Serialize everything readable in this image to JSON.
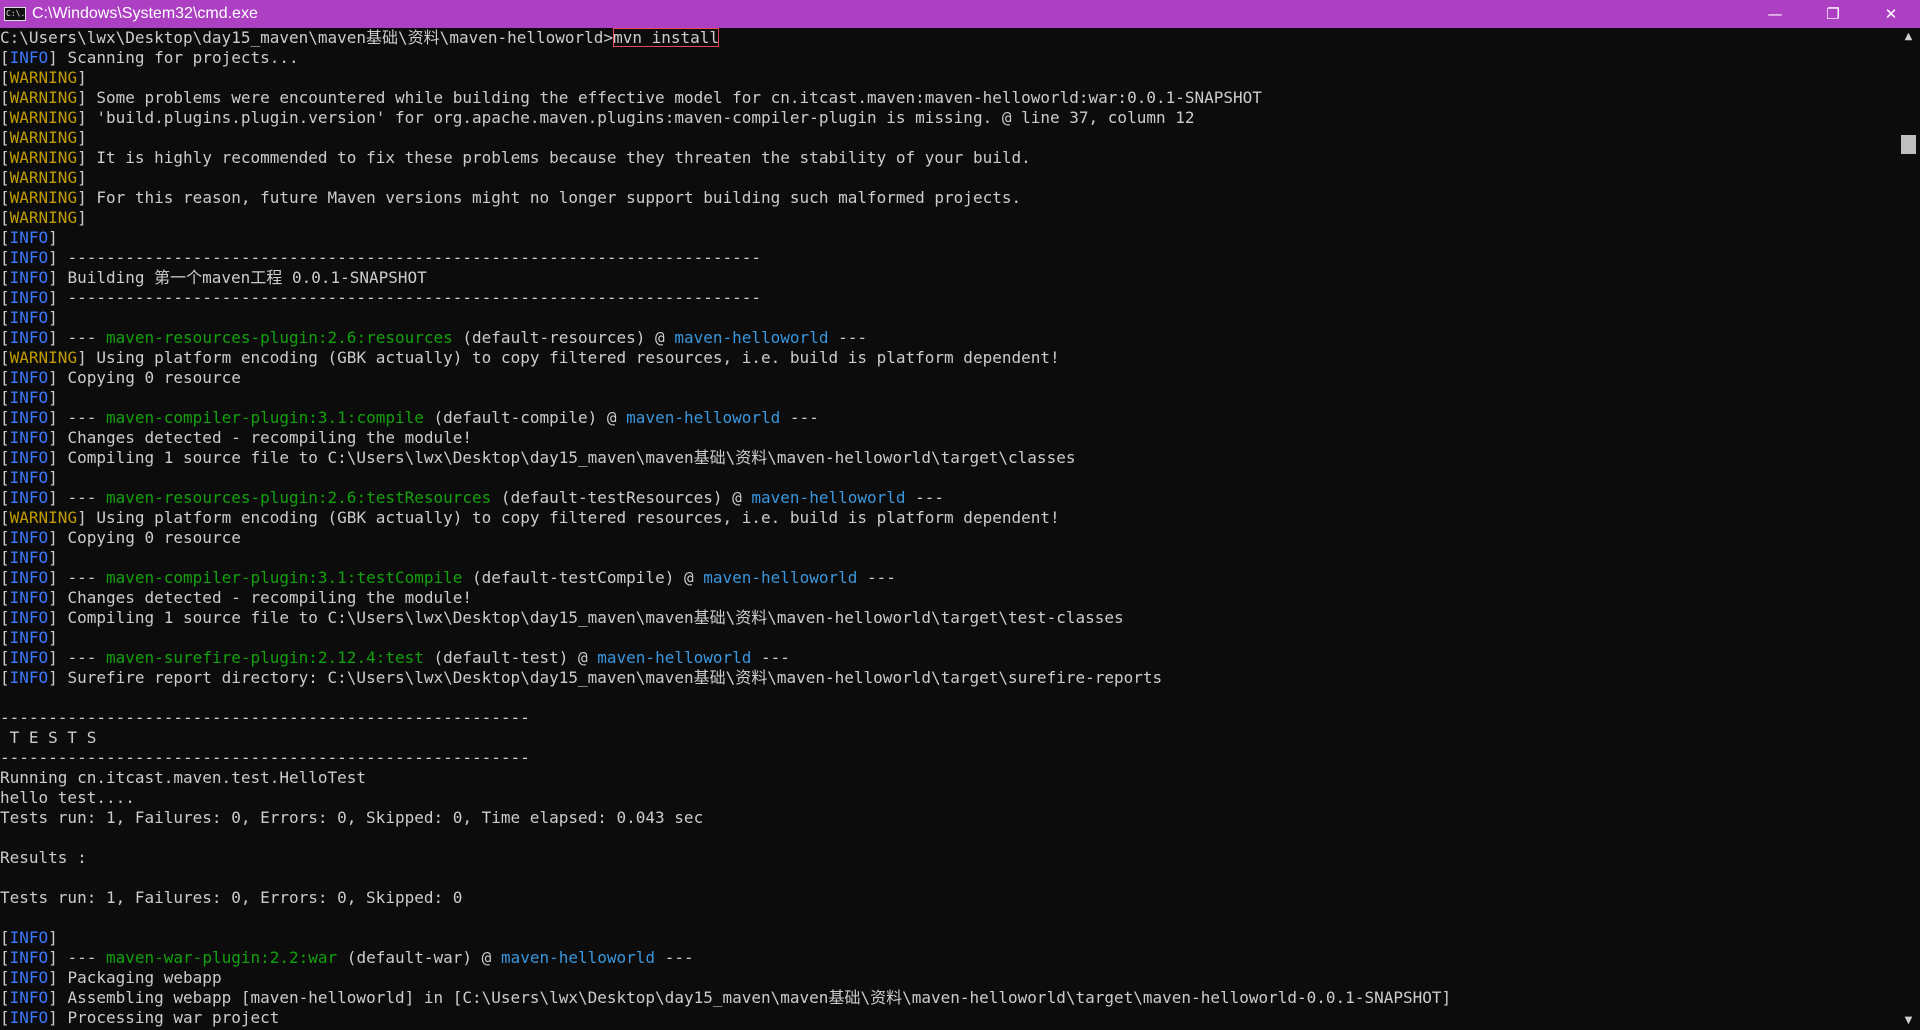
{
  "window": {
    "title": "C:\\Windows\\System32\\cmd.exe",
    "icon_name": "cmd-app-icon",
    "icon_text": "C:\\.",
    "minimize_glyph": "—",
    "maximize_glyph": "❐",
    "close_glyph": "✕",
    "title_bar_color": "#ad3fc3"
  },
  "terminal": {
    "prompt": "C:\\Users\\lwx\\Desktop\\day15_maven\\maven基础\\资料\\maven-helloworld>",
    "command": "mvn install",
    "lines": [
      {
        "tag": "INFO",
        "segs": [
          {
            "t": " Scanning for projects..."
          }
        ]
      },
      {
        "tag": "WARNING",
        "segs": []
      },
      {
        "tag": "WARNING",
        "segs": [
          {
            "t": " Some problems were encountered while building the effective model for cn.itcast.maven:maven-helloworld:war:0.0.1-SNAPSHOT"
          }
        ]
      },
      {
        "tag": "WARNING",
        "segs": [
          {
            "t": " 'build.plugins.plugin.version' for org.apache.maven.plugins:maven-compiler-plugin is missing. @ line 37, column 12"
          }
        ]
      },
      {
        "tag": "WARNING",
        "segs": []
      },
      {
        "tag": "WARNING",
        "segs": [
          {
            "t": " It is highly recommended to fix these problems because they threaten the stability of your build."
          }
        ]
      },
      {
        "tag": "WARNING",
        "segs": []
      },
      {
        "tag": "WARNING",
        "segs": [
          {
            "t": " For this reason, future Maven versions might no longer support building such malformed projects."
          }
        ]
      },
      {
        "tag": "WARNING",
        "segs": []
      },
      {
        "tag": "INFO",
        "segs": []
      },
      {
        "tag": "INFO",
        "segs": [
          {
            "t": " ------------------------------------------------------------------------"
          }
        ]
      },
      {
        "tag": "INFO",
        "segs": [
          {
            "t": " Building 第一个maven工程 0.0.1-SNAPSHOT"
          }
        ]
      },
      {
        "tag": "INFO",
        "segs": [
          {
            "t": " ------------------------------------------------------------------------"
          }
        ]
      },
      {
        "tag": "INFO",
        "segs": []
      },
      {
        "tag": "INFO",
        "segs": [
          {
            "t": " --- "
          },
          {
            "t": "maven-resources-plugin:2.6:resources",
            "c": "g"
          },
          {
            "t": " (default-resources) @ "
          },
          {
            "t": "maven-helloworld",
            "c": "c"
          },
          {
            "t": " ---"
          }
        ]
      },
      {
        "tag": "WARNING",
        "segs": [
          {
            "t": " Using platform encoding (GBK actually) to copy filtered resources, i.e. build is platform dependent!"
          }
        ]
      },
      {
        "tag": "INFO",
        "segs": [
          {
            "t": " Copying 0 resource"
          }
        ]
      },
      {
        "tag": "INFO",
        "segs": []
      },
      {
        "tag": "INFO",
        "segs": [
          {
            "t": " --- "
          },
          {
            "t": "maven-compiler-plugin:3.1:compile",
            "c": "g"
          },
          {
            "t": " (default-compile) @ "
          },
          {
            "t": "maven-helloworld",
            "c": "c"
          },
          {
            "t": " ---"
          }
        ]
      },
      {
        "tag": "INFO",
        "segs": [
          {
            "t": " Changes detected - recompiling the module!"
          }
        ]
      },
      {
        "tag": "INFO",
        "segs": [
          {
            "t": " Compiling 1 source file to C:\\Users\\lwx\\Desktop\\day15_maven\\maven基础\\资料\\maven-helloworld\\target\\classes"
          }
        ]
      },
      {
        "tag": "INFO",
        "segs": []
      },
      {
        "tag": "INFO",
        "segs": [
          {
            "t": " --- "
          },
          {
            "t": "maven-resources-plugin:2.6:testResources",
            "c": "g"
          },
          {
            "t": " (default-testResources) @ "
          },
          {
            "t": "maven-helloworld",
            "c": "c"
          },
          {
            "t": " ---"
          }
        ]
      },
      {
        "tag": "WARNING",
        "segs": [
          {
            "t": " Using platform encoding (GBK actually) to copy filtered resources, i.e. build is platform dependent!"
          }
        ]
      },
      {
        "tag": "INFO",
        "segs": [
          {
            "t": " Copying 0 resource"
          }
        ]
      },
      {
        "tag": "INFO",
        "segs": []
      },
      {
        "tag": "INFO",
        "segs": [
          {
            "t": " --- "
          },
          {
            "t": "maven-compiler-plugin:3.1:testCompile",
            "c": "g"
          },
          {
            "t": " (default-testCompile) @ "
          },
          {
            "t": "maven-helloworld",
            "c": "c"
          },
          {
            "t": " ---"
          }
        ]
      },
      {
        "tag": "INFO",
        "segs": [
          {
            "t": " Changes detected - recompiling the module!"
          }
        ]
      },
      {
        "tag": "INFO",
        "segs": [
          {
            "t": " Compiling 1 source file to C:\\Users\\lwx\\Desktop\\day15_maven\\maven基础\\资料\\maven-helloworld\\target\\test-classes"
          }
        ]
      },
      {
        "tag": "INFO",
        "segs": []
      },
      {
        "tag": "INFO",
        "segs": [
          {
            "t": " --- "
          },
          {
            "t": "maven-surefire-plugin:2.12.4:test",
            "c": "g"
          },
          {
            "t": " (default-test) @ "
          },
          {
            "t": "maven-helloworld",
            "c": "c"
          },
          {
            "t": " ---"
          }
        ]
      },
      {
        "tag": "INFO",
        "segs": [
          {
            "t": " Surefire report directory: C:\\Users\\lwx\\Desktop\\day15_maven\\maven基础\\资料\\maven-helloworld\\target\\surefire-reports"
          }
        ]
      },
      {
        "tag": "",
        "segs": []
      },
      {
        "tag": "",
        "segs": [
          {
            "t": "-------------------------------------------------------"
          }
        ]
      },
      {
        "tag": "",
        "segs": [
          {
            "t": " T E S T S"
          }
        ]
      },
      {
        "tag": "",
        "segs": [
          {
            "t": "-------------------------------------------------------"
          }
        ]
      },
      {
        "tag": "",
        "segs": [
          {
            "t": "Running cn.itcast.maven.test.HelloTest"
          }
        ]
      },
      {
        "tag": "",
        "segs": [
          {
            "t": "hello test...."
          }
        ]
      },
      {
        "tag": "",
        "segs": [
          {
            "t": "Tests run: 1, Failures: 0, Errors: 0, Skipped: 0, Time elapsed: 0.043 sec"
          }
        ]
      },
      {
        "tag": "",
        "segs": []
      },
      {
        "tag": "",
        "segs": [
          {
            "t": "Results :"
          }
        ]
      },
      {
        "tag": "",
        "segs": []
      },
      {
        "tag": "",
        "segs": [
          {
            "t": "Tests run: 1, Failures: 0, Errors: 0, Skipped: 0"
          }
        ]
      },
      {
        "tag": "",
        "segs": []
      },
      {
        "tag": "INFO",
        "segs": []
      },
      {
        "tag": "INFO",
        "segs": [
          {
            "t": " --- "
          },
          {
            "t": "maven-war-plugin:2.2:war",
            "c": "g"
          },
          {
            "t": " (default-war) @ "
          },
          {
            "t": "maven-helloworld",
            "c": "c"
          },
          {
            "t": " ---"
          }
        ]
      },
      {
        "tag": "INFO",
        "segs": [
          {
            "t": " Packaging webapp"
          }
        ]
      },
      {
        "tag": "INFO",
        "segs": [
          {
            "t": " Assembling webapp [maven-helloworld] in [C:\\Users\\lwx\\Desktop\\day15_maven\\maven基础\\资料\\maven-helloworld\\target\\maven-helloworld-0.0.1-SNAPSHOT]"
          }
        ]
      },
      {
        "tag": "INFO",
        "segs": [
          {
            "t": " Processing war project"
          }
        ]
      }
    ]
  },
  "scrollbar": {
    "up_glyph": "▲",
    "down_glyph": "▼"
  }
}
